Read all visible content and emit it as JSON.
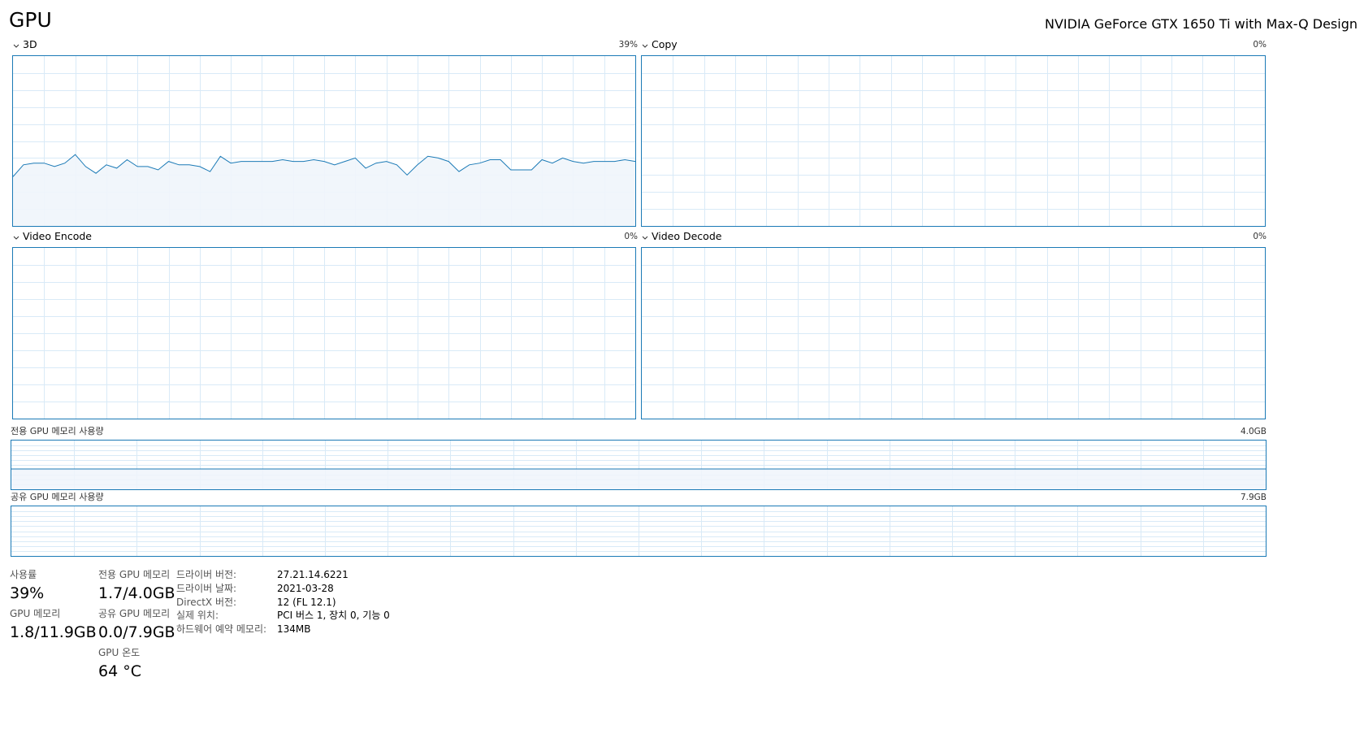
{
  "header": {
    "title": "GPU",
    "device_name": "NVIDIA GeForce GTX 1650 Ti with Max-Q Design"
  },
  "engines": [
    {
      "label": "3D",
      "percent": "39%",
      "history": [
        29,
        36,
        37,
        37,
        35,
        37,
        42,
        35,
        31,
        36,
        34,
        39,
        35,
        35,
        33,
        38,
        36,
        36,
        35,
        32,
        41,
        37,
        38,
        38,
        38,
        38,
        39,
        38,
        38,
        39,
        38,
        36,
        38,
        40,
        34,
        37,
        38,
        36,
        30,
        36,
        41,
        40,
        38,
        32,
        36,
        37,
        39,
        39,
        33,
        33,
        33,
        39,
        37,
        40,
        38,
        37,
        38,
        38,
        38,
        39,
        38
      ]
    },
    {
      "label": "Copy",
      "percent": "0%",
      "history": []
    },
    {
      "label": "Video Encode",
      "percent": "0%",
      "history": []
    },
    {
      "label": "Video Decode",
      "percent": "0%",
      "history": []
    }
  ],
  "memory_graphs": [
    {
      "label": "전용 GPU 메모리 사용량",
      "max": "4.0GB",
      "fill_fraction": 0.425
    },
    {
      "label": "공유 GPU 메모리 사용량",
      "max": "7.9GB",
      "fill_fraction": 0.0
    }
  ],
  "stats": {
    "utilization": {
      "label": "사용률",
      "value": "39%"
    },
    "dedicated_memory": {
      "label": "전용 GPU 메모리",
      "value": "1.7/4.0GB"
    },
    "gpu_memory": {
      "label": "GPU 메모리",
      "value": "1.8/11.9GB"
    },
    "shared_memory": {
      "label": "공유 GPU 메모리",
      "value": "0.0/7.9GB"
    },
    "temperature": {
      "label": "GPU 온도",
      "value": "64 °C"
    }
  },
  "properties": [
    {
      "label": "드라이버 버전:",
      "value": "27.21.14.6221"
    },
    {
      "label": "드라이버 날짜:",
      "value": "2021-03-28"
    },
    {
      "label": "DirectX 버전:",
      "value": "12 (FL 12.1)"
    },
    {
      "label": "실제 위치:",
      "value": "PCI 버스 1, 장치 0, 기능 0"
    },
    {
      "label": "하드웨어 예약 메모리:",
      "value": "134MB"
    }
  ],
  "colors": {
    "graph_border": "#1b7ab6",
    "grid_line": "#d9eaf7",
    "line": "#1b7ab6",
    "fill": "#f0f5fb"
  }
}
